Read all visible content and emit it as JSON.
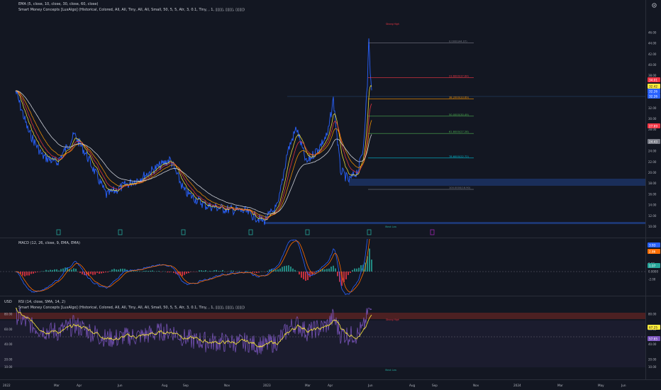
{
  "legend": {
    "ema": "EMA (5, close, 10, close, 30, close, 60, close)",
    "smc": "Smart Money Concepts [LuxAlgo] (Historical, Colored, All, All, Tiny, All, All, Small, 50, 5, 5, Atr, 3, 0.1, Tiny, , 1, ▯▯▯▯, ▯▯▯▯, ▯▯▯▯)",
    "macd": "MACD (12, 26, close, 9, EMA, EMA)",
    "rsi": "RSI (14, close, SMA, 14, 2)",
    "smc2": "Smart Money Concepts [LuxAlgo] (Historical, Colored, All, All, Tiny, All, All, Small, 50, 5, 5, Atr, 3, 0.1, Tiny, , 1, ▯▯▯▯, ▯▯▯▯, ▯▯▯▯)",
    "usd": "USD"
  },
  "chart_data": [
    {
      "type": "line",
      "panel": "price",
      "x": [
        "2022-01",
        "2022-03",
        "2022-04",
        "2022-06",
        "2022-08",
        "2022-09",
        "2022-11",
        "2023-01",
        "2023-03",
        "2023-04",
        "2023-06"
      ],
      "series": [
        {
          "name": "Price",
          "values": [
            32.0,
            24.0,
            22.0,
            18.0,
            22.0,
            13.5,
            11.5,
            12.0,
            29.0,
            22.0,
            34.0
          ]
        }
      ],
      "y_ticks": [
        "10.00",
        "12.00",
        "14.00",
        "16.00",
        "18.00",
        "20.00",
        "22.00",
        "24.00",
        "26.00",
        "28.00",
        "30.00",
        "32.00",
        "34.00",
        "36.00",
        "38.00",
        "40.00",
        "42.00",
        "44.00",
        "46.00"
      ],
      "x_ticks": [
        "2022",
        "Mar",
        "Apr",
        "Jun",
        "Aug",
        "Sep",
        "Nov",
        "2023",
        "Mar",
        "Apr",
        "Jun",
        "Aug",
        "Sep",
        "Nov",
        "2024",
        "Mar",
        "May",
        "Jun"
      ],
      "price_labels": [
        {
          "text": "34.01",
          "color": "#f23645"
        },
        {
          "text": "32.42",
          "color": "#ffeb3b"
        },
        {
          "text": "32.26",
          "color": "#2962ff"
        },
        {
          "text": "32.26",
          "color": "#2962ff"
        },
        {
          "text": "27.69",
          "color": "#f23645"
        },
        {
          "text": "24.43",
          "color": "#787b86"
        }
      ],
      "fib": [
        {
          "text": "0.0000(44.07)",
          "value": 44.07,
          "color": "#787b86"
        },
        {
          "text": "23.6000(37.64)",
          "value": 37.64,
          "color": "#f23645"
        },
        {
          "text": "38.2000(33.69)",
          "value": 33.69,
          "color": "#ff9800"
        },
        {
          "text": "50.0000(30.49)",
          "value": 30.49,
          "color": "#4caf50"
        },
        {
          "text": "61.8000(27.28)",
          "value": 27.28,
          "color": "#4caf50"
        },
        {
          "text": "78.6000(22.72)",
          "value": 22.72,
          "color": "#00bcd4"
        },
        {
          "text": "100.0000(16.90)",
          "value": 16.9,
          "color": "#787b86"
        }
      ],
      "annotations": [
        "Strong High",
        "Weak Low"
      ]
    },
    {
      "type": "line",
      "panel": "macd",
      "y_ticks": [
        "2.00",
        "0.0000",
        "-2.00"
      ],
      "price_labels": [
        {
          "text": "3.93",
          "color": "#2962ff"
        },
        {
          "text": "2.86",
          "color": "#ff6d00"
        },
        {
          "text": "1.07",
          "color": "#26a69a"
        }
      ]
    },
    {
      "type": "line",
      "panel": "rsi",
      "y_ticks": [
        "80.00",
        "60.00",
        "40.00",
        "20.00",
        "10.00"
      ],
      "price_labels": [
        {
          "text": "67.25",
          "color": "#ffeb3b"
        },
        {
          "text": "57.65",
          "color": "#7e57c2"
        }
      ],
      "annotations": [
        "Strong High",
        "Weak Low"
      ]
    }
  ]
}
